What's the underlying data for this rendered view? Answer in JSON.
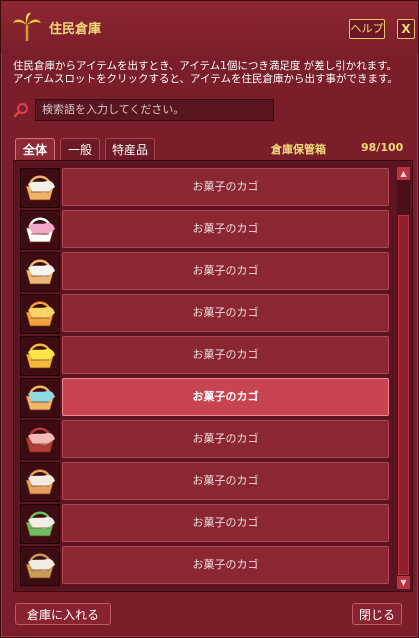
{
  "window": {
    "title": "住民倉庫",
    "icon": "palm-sprout-icon",
    "help_label": "ヘルプ",
    "close_label": "X"
  },
  "description": {
    "line1": "住民倉庫からアイテムを出すとき、アイテム1個につき満足度 が差し引かれます。",
    "line2": "アイテムスロットをクリックすると、アイテムを住民倉庫から出す事ができます。"
  },
  "search": {
    "icon": "magnifier-icon",
    "placeholder": "検索語を入力してください。"
  },
  "tabs": [
    {
      "label": "全体",
      "active": true
    },
    {
      "label": "一般",
      "active": false
    },
    {
      "label": "特産品",
      "active": false
    }
  ],
  "storage": {
    "label": "倉庫保管箱",
    "count": "98/100"
  },
  "items": [
    {
      "name": "お菓子のカゴ",
      "cloth_color": "#f5f0ea",
      "accent": "#f1b36a",
      "selected": false
    },
    {
      "name": "お菓子のカゴ",
      "cloth_color": "#f4a7c9",
      "accent": "#ffffff",
      "selected": false
    },
    {
      "name": "お菓子のカゴ",
      "cloth_color": "#f7f3ef",
      "accent": "#f0b878",
      "selected": false
    },
    {
      "name": "お菓子のカゴ",
      "cloth_color": "#fbd36a",
      "accent": "#f3a23c",
      "selected": false
    },
    {
      "name": "お菓子のカゴ",
      "cloth_color": "#ffe64a",
      "accent": "#f2b93a",
      "selected": false
    },
    {
      "name": "お菓子のカゴ",
      "cloth_color": "#8fd9e3",
      "accent": "#f2b56a",
      "selected": true
    },
    {
      "name": "お菓子のカゴ",
      "cloth_color": "#f3b8b8",
      "accent": "#b63a3a",
      "selected": false
    },
    {
      "name": "お菓子のカゴ",
      "cloth_color": "#f5eadf",
      "accent": "#e5a061",
      "selected": false
    },
    {
      "name": "お菓子のカゴ",
      "cloth_color": "#f3efe8",
      "accent": "#6bbf5e",
      "selected": false
    },
    {
      "name": "お菓子のカゴ",
      "cloth_color": "#f4ece1",
      "accent": "#c99a5a",
      "selected": false
    }
  ],
  "footer": {
    "store_label": "倉庫に入れる",
    "close_label": "閉じる"
  },
  "colors": {
    "window_bg": "#7a1f2a",
    "title_text": "#f3d97a",
    "selected_row": "#c84452"
  }
}
